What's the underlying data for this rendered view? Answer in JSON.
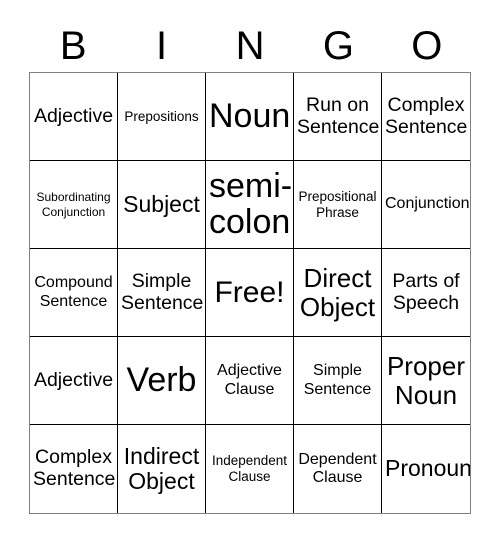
{
  "card": {
    "header_letters": [
      "B",
      "I",
      "N",
      "G",
      "O"
    ],
    "free_space_label": "Free!",
    "colors": {
      "background": "#ffffff",
      "text": "#000000",
      "grid_line": "#000000",
      "outer_border": "#808080"
    },
    "grid": {
      "rows": 5,
      "columns": 5,
      "cells": [
        {
          "text": "Adjective",
          "size": "fs-lg"
        },
        {
          "text": "Prepositions",
          "size": "fs-sm"
        },
        {
          "text": "Noun",
          "size": "fs-4xl"
        },
        {
          "text": "Run on Sentence",
          "size": "fs-lg"
        },
        {
          "text": "Complex Sentence",
          "size": "fs-lg"
        },
        {
          "text": "Subordinating Conjunction",
          "size": "fs-xs"
        },
        {
          "text": "Subject",
          "size": "fs-xl"
        },
        {
          "text": "semi-colon",
          "size": "fs-4xl"
        },
        {
          "text": "Prepositional Phrase",
          "size": "fs-sm"
        },
        {
          "text": "Conjunction",
          "size": "fs-md"
        },
        {
          "text": "Compound Sentence",
          "size": "fs-md"
        },
        {
          "text": "Simple Sentence",
          "size": "fs-lg"
        },
        {
          "text": "Free!",
          "size": "fs-3xl"
        },
        {
          "text": "Direct Object",
          "size": "fs-2xl"
        },
        {
          "text": "Parts of Speech",
          "size": "fs-lg"
        },
        {
          "text": "Adjective",
          "size": "fs-lg"
        },
        {
          "text": "Verb",
          "size": "fs-4xl"
        },
        {
          "text": "Adjective Clause",
          "size": "fs-md"
        },
        {
          "text": "Simple Sentence",
          "size": "fs-md"
        },
        {
          "text": "Proper Noun",
          "size": "fs-2xl"
        },
        {
          "text": "Complex Sentence",
          "size": "fs-lg"
        },
        {
          "text": "Indirect Object",
          "size": "fs-xl"
        },
        {
          "text": "Independent Clause",
          "size": "fs-sm"
        },
        {
          "text": "Dependent Clause",
          "size": "fs-md"
        },
        {
          "text": "Pronoun",
          "size": "fs-xl"
        }
      ]
    }
  }
}
